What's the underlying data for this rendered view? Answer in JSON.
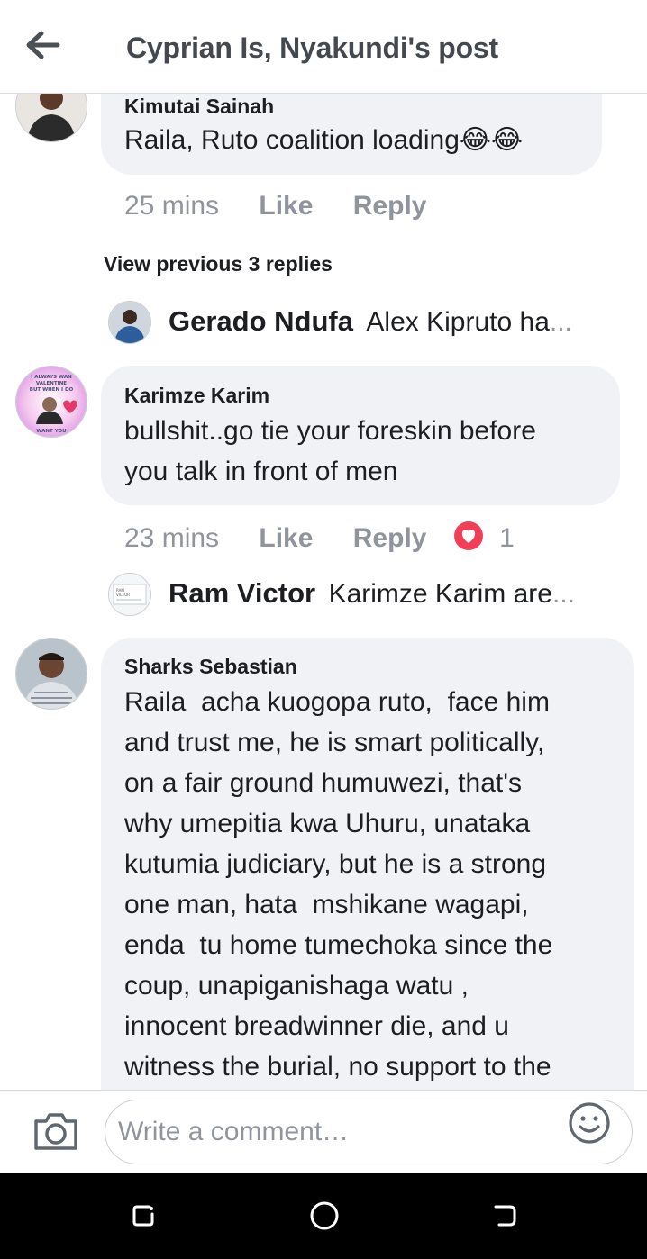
{
  "header": {
    "title": "Cyprian Is, Nyakundi's post",
    "back_icon": "arrow-left-icon"
  },
  "comments": [
    {
      "author": "Kimutai Sainah",
      "text": "Raila, Ruto coalition loading",
      "emoji": "😂😂",
      "time": "25 mins",
      "like_label": "Like",
      "reply_label": "Reply"
    },
    {
      "author": "Karimze Karim",
      "avatar_text": [
        "I ALWAYS WAN",
        "VALENTINE",
        "BUT WHEN I DO",
        "WANT YOU"
      ],
      "text_lines": [
        "bullshit..go tie your foreskin before",
        "you talk in front of men"
      ],
      "time": "23 mins",
      "like_label": "Like",
      "reply_label": "Reply",
      "reaction_count": "1"
    },
    {
      "author": "Sharks Sebastian",
      "text_lines": [
        "Raila  acha kuogopa ruto,  face him",
        "and trust me, he is smart politically,",
        "on a fair ground humuwezi, that's",
        "why umepitia kwa Uhuru, unataka",
        "kutumia judiciary, but he is a strong",
        "one man, hata  mshikane wagapi,",
        "enda  tu home tumechoka since the",
        "coup, unapiganishaga watu ,",
        "innocent breadwinner die, and u",
        "witness the burial, no support to the"
      ]
    }
  ],
  "view_previous_replies": "View previous 3 replies",
  "replies": [
    {
      "name": "Gerado Ndufa",
      "preview": "Alex Kipruto ha",
      "ellipsis": "..."
    },
    {
      "name": "Ram Victor",
      "avatar_text": [
        "RAM",
        "VICTOR"
      ],
      "preview": "Karimze Karim are",
      "ellipsis": "..."
    }
  ],
  "composer": {
    "placeholder": "Write a comment",
    "ellipsis": "…",
    "camera_icon": "camera-icon",
    "emoji_icon": "smiley-icon"
  },
  "navbar": {
    "icons": [
      "recent-apps-icon",
      "home-icon",
      "back-icon"
    ]
  },
  "colors": {
    "bubble": "#f0f2f5",
    "meta_gray": "#90949c",
    "title_gray": "#444950",
    "love_reaction": "#f33e58"
  }
}
